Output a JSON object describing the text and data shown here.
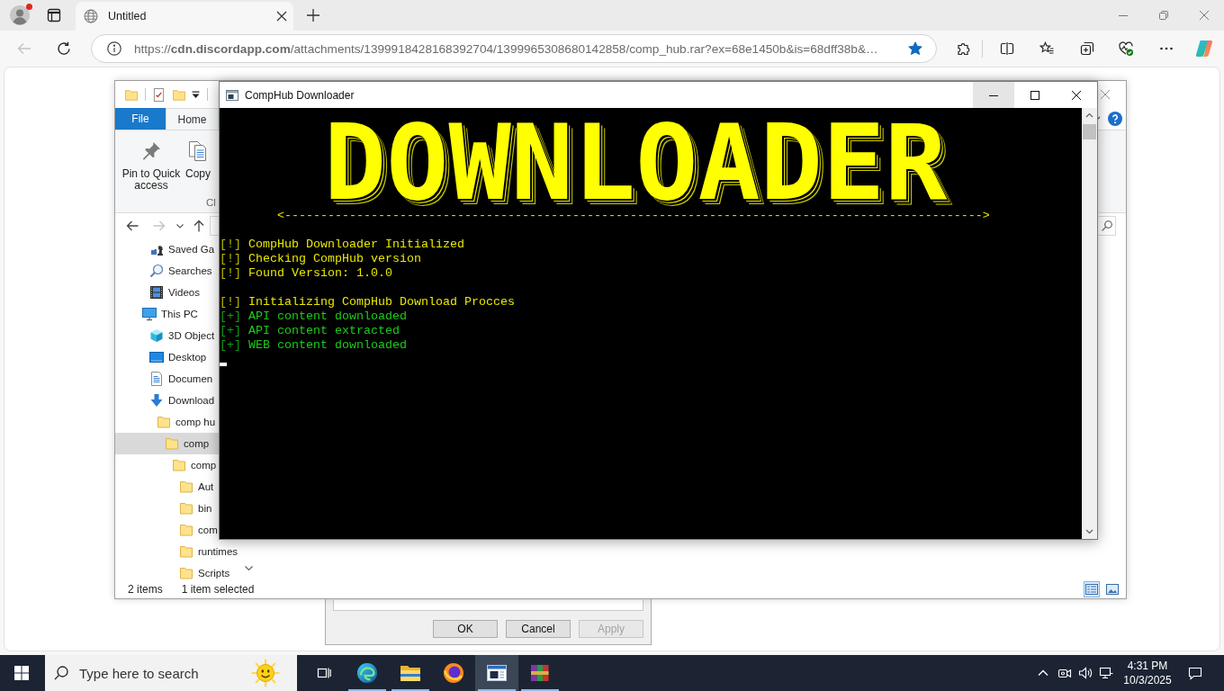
{
  "browser": {
    "profile_badge": true,
    "tab": {
      "title": "Untitled"
    },
    "back_disabled": true,
    "url": "https://**cdn.discordapp.com**/attachments/1399918428168392704/1399965308680142858/comp_hub.rar?ex=68e1450b&is=68dff38b&…",
    "favorite": true
  },
  "explorer": {
    "ribbon_tabs": [
      {
        "label": "File",
        "kind": "file",
        "selected": false
      },
      {
        "label": "Home",
        "kind": "tab",
        "selected": true
      }
    ],
    "ribbon_buttons": [
      {
        "label": "Pin to Quick access",
        "kind": "pin"
      },
      {
        "label": "Copy",
        "kind": "copy"
      }
    ],
    "ribbon_group_label": "Cl",
    "forward_disabled": true,
    "nav_tree": [
      {
        "children": [
          {
            "label": "Saved Ga",
            "kind": "saved-games",
            "selected": false
          },
          {
            "label": "Searches",
            "kind": "searches",
            "selected": false
          },
          {
            "label": "Videos",
            "kind": "videos",
            "selected": false
          }
        ]
      },
      {
        "label": "This PC",
        "kind": "pc",
        "selected": false,
        "children": [
          {
            "label": "3D Object",
            "kind": "objects",
            "selected": false
          },
          {
            "label": "Desktop",
            "kind": "desktop",
            "selected": false
          },
          {
            "label": "Documen",
            "kind": "documents",
            "selected": false
          },
          {
            "label": "Download",
            "kind": "downloads",
            "selected": false,
            "children": [
              {
                "label": "comp hu",
                "kind": "folder",
                "selected": false,
                "children": [
                  {
                    "label": "comp",
                    "kind": "folder",
                    "selected": true,
                    "children": [
                      {
                        "label": "comp",
                        "kind": "folder",
                        "selected": false,
                        "children": [
                          {
                            "label": "Aut",
                            "kind": "folder",
                            "selected": false
                          },
                          {
                            "label": "bin",
                            "kind": "folder",
                            "selected": false
                          },
                          {
                            "label": "com",
                            "kind": "folder",
                            "selected": false
                          },
                          {
                            "label": "runtimes",
                            "kind": "folder",
                            "selected": false
                          },
                          {
                            "label": "Scripts",
                            "kind": "folder",
                            "selected": false
                          }
                        ]
                      }
                    ]
                  }
                ]
              }
            ]
          }
        ]
      }
    ],
    "status": {
      "item_count": "2 items",
      "selection": "1 item selected"
    },
    "view_buttons": [
      {
        "kind": "details",
        "selected": true
      },
      {
        "kind": "large-icons",
        "selected": false
      }
    ]
  },
  "console": {
    "title": "CompHub Downloader",
    "controls": [
      {
        "kind": "minimize",
        "hovered": true
      },
      {
        "kind": "maximize",
        "hovered": false
      },
      {
        "kind": "close",
        "hovered": false
      }
    ],
    "banner": "DOWNLOADER",
    "divider": "<------------------------------------------------------------------------------------------------->",
    "lines": [
      {
        "kind": "info",
        "prefix": "[!]",
        "text": "CompHub Downloader Initialized"
      },
      {
        "kind": "info",
        "prefix": "[!]",
        "text": "Checking CompHub version"
      },
      {
        "kind": "info",
        "prefix": "[!]",
        "text": "Found Version: 1.0.0"
      },
      {
        "kind": "blank"
      },
      {
        "kind": "info",
        "prefix": "[!]",
        "text": "Initializing CompHub Download Procces"
      },
      {
        "kind": "success",
        "prefix": "[+]",
        "text": "API content downloaded"
      },
      {
        "kind": "success",
        "prefix": "[+]",
        "text": "API content extracted"
      },
      {
        "kind": "success",
        "prefix": "[+]",
        "text": "WEB content downloaded"
      }
    ]
  },
  "properties_dialog": {
    "buttons": [
      {
        "label": "OK",
        "disabled": false
      },
      {
        "label": "Cancel",
        "disabled": false
      },
      {
        "label": "Apply",
        "disabled": true
      }
    ]
  },
  "taskbar": {
    "search_placeholder": "Type here to search",
    "apps": [
      {
        "kind": "browser",
        "running": true,
        "selected": false
      },
      {
        "kind": "files",
        "running": true,
        "selected": false
      },
      {
        "kind": "browser-alt",
        "running": false,
        "selected": false
      },
      {
        "kind": "console",
        "running": true,
        "selected": true
      },
      {
        "kind": "archiver",
        "running": true,
        "selected": false
      }
    ],
    "time": "4:31 PM",
    "date": "10/3/2025"
  }
}
